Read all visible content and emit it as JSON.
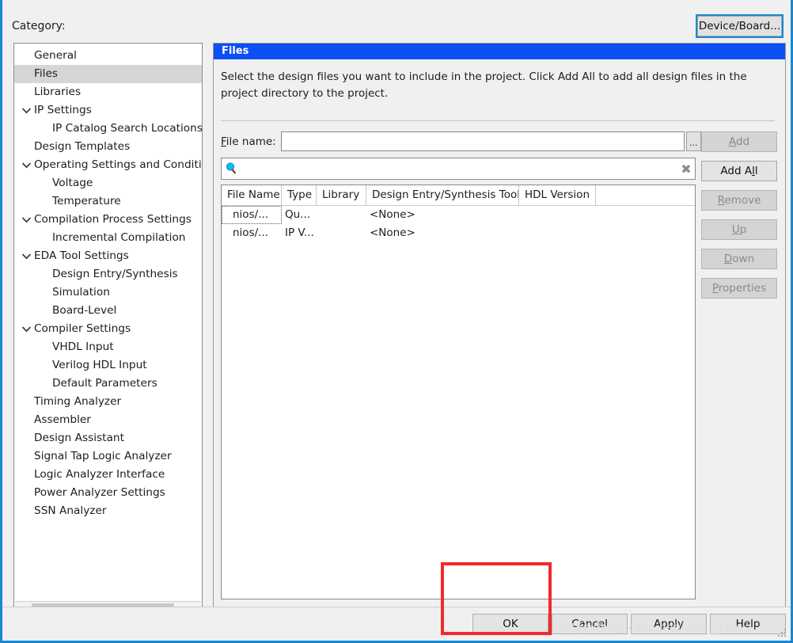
{
  "header": {
    "category_label": "Category:",
    "device_board_button": "Device/Board..."
  },
  "sidebar": {
    "items": [
      {
        "label": "General",
        "indent": 1,
        "expandable": false,
        "selected": false
      },
      {
        "label": "Files",
        "indent": 1,
        "expandable": false,
        "selected": true
      },
      {
        "label": "Libraries",
        "indent": 1,
        "expandable": false,
        "selected": false
      },
      {
        "label": "IP Settings",
        "indent": 1,
        "expandable": true,
        "selected": false
      },
      {
        "label": "IP Catalog Search Locations",
        "indent": 2,
        "expandable": false,
        "selected": false
      },
      {
        "label": "Design Templates",
        "indent": 1,
        "expandable": false,
        "selected": false
      },
      {
        "label": "Operating Settings and Conditions",
        "indent": 1,
        "expandable": true,
        "selected": false
      },
      {
        "label": "Voltage",
        "indent": 2,
        "expandable": false,
        "selected": false
      },
      {
        "label": "Temperature",
        "indent": 2,
        "expandable": false,
        "selected": false
      },
      {
        "label": "Compilation Process Settings",
        "indent": 1,
        "expandable": true,
        "selected": false
      },
      {
        "label": "Incremental Compilation",
        "indent": 2,
        "expandable": false,
        "selected": false
      },
      {
        "label": "EDA Tool Settings",
        "indent": 1,
        "expandable": true,
        "selected": false
      },
      {
        "label": "Design Entry/Synthesis",
        "indent": 2,
        "expandable": false,
        "selected": false
      },
      {
        "label": "Simulation",
        "indent": 2,
        "expandable": false,
        "selected": false
      },
      {
        "label": "Board-Level",
        "indent": 2,
        "expandable": false,
        "selected": false
      },
      {
        "label": "Compiler Settings",
        "indent": 1,
        "expandable": true,
        "selected": false
      },
      {
        "label": "VHDL Input",
        "indent": 2,
        "expandable": false,
        "selected": false
      },
      {
        "label": "Verilog HDL Input",
        "indent": 2,
        "expandable": false,
        "selected": false
      },
      {
        "label": "Default Parameters",
        "indent": 2,
        "expandable": false,
        "selected": false
      },
      {
        "label": "Timing Analyzer",
        "indent": 1,
        "expandable": false,
        "selected": false
      },
      {
        "label": "Assembler",
        "indent": 1,
        "expandable": false,
        "selected": false
      },
      {
        "label": "Design Assistant",
        "indent": 1,
        "expandable": false,
        "selected": false
      },
      {
        "label": "Signal Tap Logic Analyzer",
        "indent": 1,
        "expandable": false,
        "selected": false
      },
      {
        "label": "Logic Analyzer Interface",
        "indent": 1,
        "expandable": false,
        "selected": false
      },
      {
        "label": "Power Analyzer Settings",
        "indent": 1,
        "expandable": false,
        "selected": false
      },
      {
        "label": "SSN Analyzer",
        "indent": 1,
        "expandable": false,
        "selected": false
      }
    ],
    "scroll_left_arrow": "‹",
    "scroll_right_arrow": "›"
  },
  "panel": {
    "title": "Files",
    "description": "Select the design files you want to include in the project. Click Add All to add all design files in the project directory to the project.",
    "file_name_label": "File name:",
    "file_name_value": "",
    "browse_button": "...",
    "search_value": "",
    "clear_label": "✖"
  },
  "table": {
    "columns": [
      "File Name",
      "Type",
      "Library",
      "Design Entry/Synthesis Tool",
      "HDL Version",
      ""
    ],
    "rows": [
      {
        "file_name": "nios/...",
        "type": "Qu...",
        "library": "",
        "tool": "<None>",
        "hdl_version": "",
        "extra": "",
        "focused": true
      },
      {
        "file_name": "nios/...",
        "type": "IP V...",
        "library": "",
        "tool": "<None>",
        "hdl_version": "",
        "extra": "",
        "focused": false
      }
    ]
  },
  "side_buttons": [
    {
      "label": "Add",
      "mnemonic": "A",
      "enabled": false
    },
    {
      "label": "Add All",
      "mnemonic": "l",
      "enabled": true
    },
    {
      "label": "Remove",
      "mnemonic": "R",
      "enabled": false
    },
    {
      "label": "Up",
      "mnemonic": "U",
      "enabled": false
    },
    {
      "label": "Down",
      "mnemonic": "D",
      "enabled": false
    },
    {
      "label": "Properties",
      "mnemonic": "P",
      "enabled": false
    }
  ],
  "bottom_buttons": {
    "ok": "OK",
    "cancel": "Cancel",
    "apply": "Apply",
    "help": "Help"
  },
  "watermark": "https://blog.csdn.net/little__cats",
  "colors": {
    "panel_title_blue": "#0b4ff5",
    "focus_blue": "#1a87d2",
    "highlight_red": "#f42929",
    "selection_gray": "#d6d6d6"
  }
}
